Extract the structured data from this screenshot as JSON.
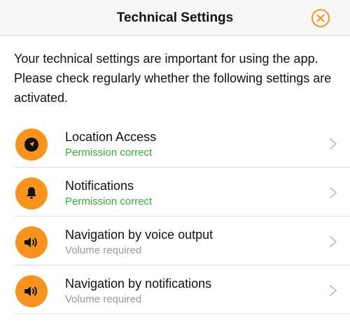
{
  "header": {
    "title": "Technical Settings",
    "close_icon": "close-circle-icon"
  },
  "intro": {
    "text": "Your technical settings are important for using the app. Please check regularly whether the following settings are activated."
  },
  "colors": {
    "accent": "#f7931e",
    "status_ok": "#3aa63a",
    "status_required": "#999999"
  },
  "settings": [
    {
      "label": "Location Access",
      "status": "Permission correct",
      "status_kind": "ok",
      "icon": "location-arrow-icon"
    },
    {
      "label": "Notifications",
      "status": "Permission correct",
      "status_kind": "ok",
      "icon": "bell-icon"
    },
    {
      "label": "Navigation by voice output",
      "status": "Volume required",
      "status_kind": "required",
      "icon": "speaker-icon"
    },
    {
      "label": "Navigation by notifications",
      "status": "Volume required",
      "status_kind": "required",
      "icon": "speaker-icon"
    }
  ]
}
